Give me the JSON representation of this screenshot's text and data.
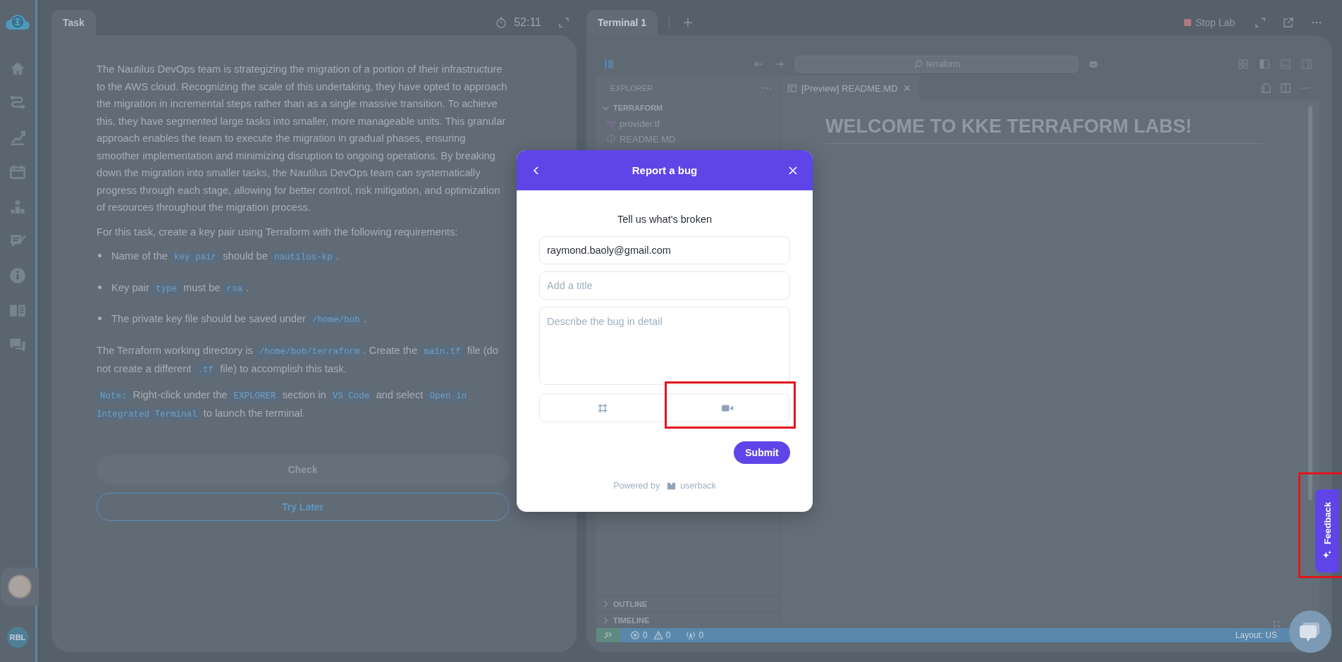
{
  "sidebar": {
    "avatar_initials": "RBL"
  },
  "task": {
    "tab": "Task",
    "timer": "52:11",
    "paragraphs": [
      {
        "kind": "para",
        "parts": [
          {
            "kind": "text",
            "text": "The Nautilus DevOps team is strategizing the migration of a portion of their infrastructure to the AWS cloud. Recognizing the scale of this undertaking, they have opted to approach the migration in incremental steps rather than as a single massive transition. To achieve this, they have segmented large tasks into smaller, more manageable units. This granular approach enables the team to execute the migration in gradual phases, ensuring smoother implementation and minimizing disruption to ongoing operations. By breaking down the migration into smaller tasks, the Nautilus DevOps team can systematically progress through each stage, allowing for better control, risk mitigation, and optimization of resources throughout the migration process."
          }
        ]
      },
      {
        "kind": "para",
        "parts": [
          {
            "kind": "text",
            "text": "For this task, create a key pair using Terraform with the following requirements:"
          }
        ]
      },
      {
        "kind": "bullet",
        "parts": [
          {
            "kind": "text",
            "text": "Name of the "
          },
          {
            "kind": "code",
            "text": "key pair"
          },
          {
            "kind": "text",
            "text": " should be "
          },
          {
            "kind": "code",
            "text": "nautilus-kp"
          },
          {
            "kind": "text",
            "text": "."
          }
        ]
      },
      {
        "kind": "bullet",
        "parts": [
          {
            "kind": "text",
            "text": "Key pair "
          },
          {
            "kind": "code",
            "text": "type"
          },
          {
            "kind": "text",
            "text": " must be "
          },
          {
            "kind": "code",
            "text": "rsa"
          },
          {
            "kind": "text",
            "text": "."
          }
        ]
      },
      {
        "kind": "bullet",
        "parts": [
          {
            "kind": "text",
            "text": "The private key file should be saved under "
          },
          {
            "kind": "code",
            "text": "/home/bob"
          },
          {
            "kind": "text",
            "text": "."
          }
        ]
      },
      {
        "kind": "para",
        "parts": [
          {
            "kind": "text",
            "text": "The Terraform working directory is "
          },
          {
            "kind": "code",
            "text": "/home/bob/terraform"
          },
          {
            "kind": "text",
            "text": ". Create the "
          },
          {
            "kind": "code",
            "text": "main.tf"
          },
          {
            "kind": "text",
            "text": " file (do not create a different "
          },
          {
            "kind": "code",
            "text": ".tf"
          },
          {
            "kind": "text",
            "text": " file) to accomplish this task."
          }
        ]
      },
      {
        "kind": "para",
        "parts": [
          {
            "kind": "code",
            "text": "Note:"
          },
          {
            "kind": "text",
            "text": " Right-click under the "
          },
          {
            "kind": "code",
            "text": "EXPLORER"
          },
          {
            "kind": "text",
            "text": " section in "
          },
          {
            "kind": "code",
            "text": "VS Code"
          },
          {
            "kind": "text",
            "text": " and select "
          },
          {
            "kind": "code",
            "text": "Open in Integrated Terminal"
          },
          {
            "kind": "text",
            "text": " to launch the terminal."
          }
        ]
      }
    ],
    "buttons": [
      {
        "label": "Check",
        "kind": "filled",
        "disabled": true
      },
      {
        "label": "Try Later",
        "kind": "outline",
        "disabled": false
      }
    ]
  },
  "terminal": {
    "tabs": [
      {
        "label": "Terminal 1",
        "selected": true
      }
    ],
    "stop_label": "Stop Lab",
    "vscode": {
      "search": "terraform",
      "explorer_title": "EXPLORER",
      "folder": {
        "label": "TERRAFORM",
        "expanded": true,
        "children": [
          {
            "label": "provider.tf",
            "kind": "terraform"
          },
          {
            "label": "README.MD",
            "kind": "info"
          }
        ]
      },
      "sections": [
        {
          "label": "OUTLINE",
          "expanded": false
        },
        {
          "label": "TIMELINE",
          "expanded": false
        }
      ],
      "editor_tab": "[Preview] README.MD",
      "heading": "WELCOME TO KKE TERRAFORM LABS!",
      "status_bar": {
        "errors": "0",
        "warnings": "0",
        "ports": "0",
        "layout": "Layout: US"
      }
    }
  },
  "bug_report": {
    "title": "Report a bug",
    "heading": "Tell us what's broken",
    "email": "raymond.baoly@gmail.com",
    "title_placeholder": "Add a title",
    "description_placeholder": "Describe the bug in detail",
    "submit": "Submit",
    "powered_by": "Powered by",
    "brand": "userback"
  },
  "feedback_tab": {
    "label": "Feedback"
  }
}
